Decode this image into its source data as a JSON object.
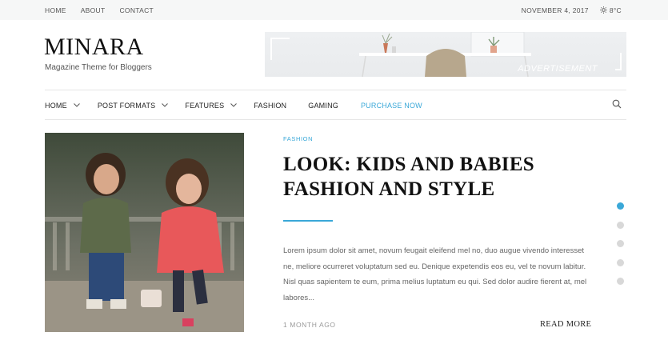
{
  "topbar": {
    "links": [
      "HOME",
      "ABOUT",
      "CONTACT"
    ],
    "date": "NOVEMBER 4, 2017",
    "weather": "8°C",
    "weather_icon": "sun-icon"
  },
  "header": {
    "logo": "MINARA",
    "tagline": "Magazine Theme for Bloggers",
    "ad_label": "ADVERTISEMENT"
  },
  "nav": {
    "items": [
      {
        "label": "HOME",
        "dropdown": true
      },
      {
        "label": "POST FORMATS",
        "dropdown": true
      },
      {
        "label": "FEATURES",
        "dropdown": true
      },
      {
        "label": "FASHION",
        "dropdown": false
      },
      {
        "label": "GAMING",
        "dropdown": false
      },
      {
        "label": "PURCHASE NOW",
        "dropdown": false
      }
    ],
    "highlight_color": "#3aa8d8",
    "search_icon": "search-icon"
  },
  "article": {
    "category": "FASHION",
    "title": "LOOK: KIDS AND BABIES FASHION AND STYLE",
    "excerpt": "Lorem ipsum dolor sit amet, novum feugait eleifend mel no, duo augue vivendo interesset ne, meliore ocurreret voluptatum sed eu. Denique expetendis eos eu, vel te novum labitur. Nisl quas sapientem te eum, prima melius luptatum eu qui. Sed dolor audire fierent at, mel labores...",
    "time_ago": "1 MONTH AGO",
    "read_more": "READ MORE"
  },
  "slider": {
    "count": 5,
    "active_index": 0
  },
  "colors": {
    "accent": "#3aa8d8",
    "topbar_bg": "#f6f7f7"
  }
}
